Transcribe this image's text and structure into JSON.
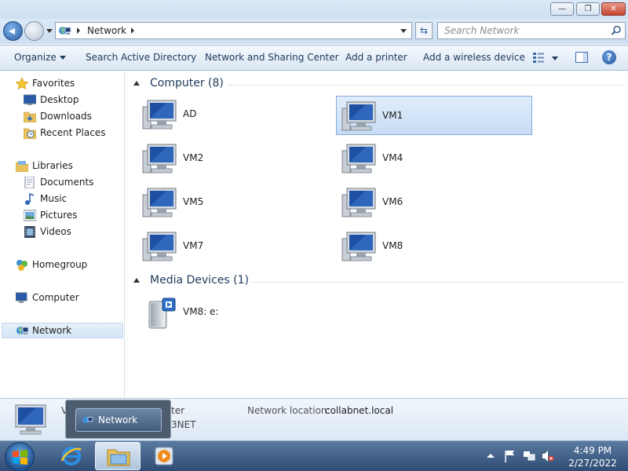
{
  "window": {
    "controls": {
      "min": "—",
      "max": "❐",
      "close": "✕"
    }
  },
  "address": {
    "crumb": "Network"
  },
  "search": {
    "placeholder": "Search Network"
  },
  "toolbar": {
    "organize": "Organize",
    "search_ad": "Search Active Directory",
    "network_sharing": "Network and Sharing Center",
    "add_printer": "Add a printer",
    "add_wireless": "Add a wireless device",
    "help": "?"
  },
  "sidebar": {
    "favorites": "Favorites",
    "desktop": "Desktop",
    "downloads": "Downloads",
    "recent": "Recent Places",
    "libraries": "Libraries",
    "documents": "Documents",
    "music": "Music",
    "pictures": "Pictures",
    "videos": "Videos",
    "homegroup": "Homegroup",
    "computer": "Computer",
    "network": "Network"
  },
  "groups": {
    "computer": "Computer (8)",
    "media": "Media Devices (1)"
  },
  "computers": [
    "AD",
    "VM1",
    "VM2",
    "VM4",
    "VM5",
    "VM6",
    "VM7",
    "VM8"
  ],
  "media_devices": [
    "VM8: e:"
  ],
  "details": {
    "line1_visible": "V",
    "line1_right": "ter",
    "line2_visible": "3NET",
    "location_key": "Network location:",
    "location_value": "collabnet.local"
  },
  "thumbnail": {
    "label": "Network"
  },
  "clock": {
    "time": "4:49 PM",
    "date": "2/27/2022"
  },
  "colors": {
    "accent": "#1e395b",
    "selection": "#c7ddf6",
    "taskbar": "#2f4c74"
  }
}
